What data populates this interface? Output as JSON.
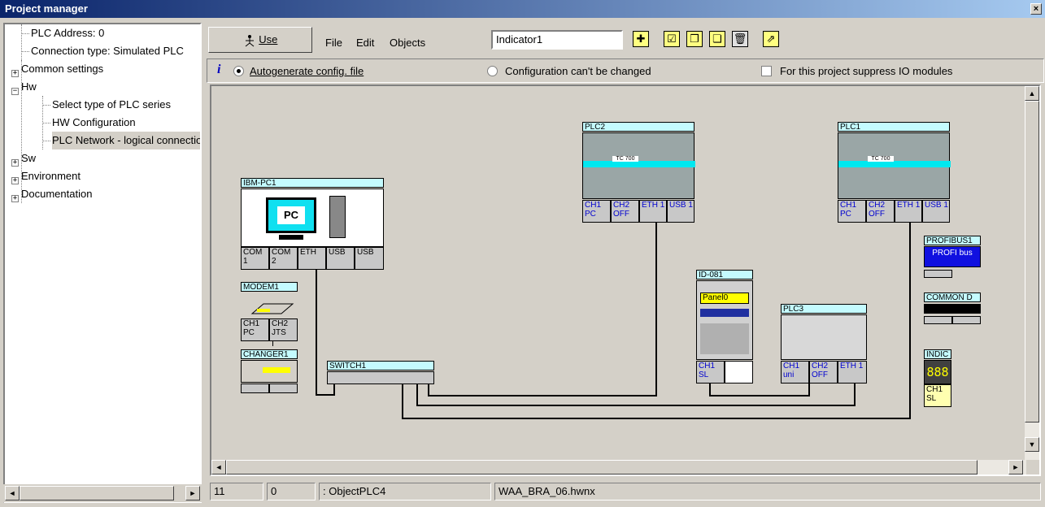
{
  "window": {
    "title": "Project manager",
    "close": "×"
  },
  "tree": {
    "items": [
      {
        "label": "PLC Address: 0"
      },
      {
        "label": "Connection type: Simulated PLC"
      },
      {
        "label": "Common settings",
        "toggle": "+"
      },
      {
        "label": "Hw",
        "toggle": "−"
      },
      {
        "label": "Select type of PLC series"
      },
      {
        "label": "HW Configuration"
      },
      {
        "label": "PLC Network - logical connections"
      },
      {
        "label": "Sw",
        "toggle": "+"
      },
      {
        "label": "Environment",
        "toggle": "+"
      },
      {
        "label": "Documentation",
        "toggle": "+"
      }
    ],
    "scroll_left": "◄",
    "scroll_right": "►"
  },
  "toolbar": {
    "use_label": "Use",
    "use_icon": "person-icon",
    "menu": [
      "File",
      "Edit",
      "Objects"
    ],
    "object_name": "Indicator1",
    "icons": [
      "new-object-icon",
      "check-icon",
      "copy-icon",
      "paste-icon",
      "delete-icon",
      "export-icon"
    ]
  },
  "options": {
    "info": "i",
    "autogen": "Autogenerate config. file",
    "cant_change": "Configuration can't be changed",
    "suppress": "For this project suppress IO modules"
  },
  "network": {
    "pc": {
      "title": "IBM-PC1",
      "screen": "PC",
      "ports": [
        "COM 1",
        "COM 2",
        "ETH",
        "USB",
        "USB"
      ]
    },
    "modem": {
      "title": "MODEM1",
      "ports": [
        "CH1 PC",
        "CH2 JTS"
      ]
    },
    "changer": {
      "title": "CHANGER1"
    },
    "switch": {
      "title": "SWITCH1"
    },
    "plc2": {
      "title": "PLC2",
      "module": "TC 700",
      "ports": [
        "CH1 PC",
        "CH2 OFF",
        "ETH 1",
        "USB 1"
      ]
    },
    "plc1": {
      "title": "PLC1",
      "module": "TC 700",
      "ports": [
        "CH1 PC",
        "CH2 OFF",
        "ETH 1",
        "USB 1"
      ]
    },
    "panel": {
      "title": "ID-081",
      "display": "Panel0",
      "ports": [
        "CH1 SL"
      ]
    },
    "plc3": {
      "title": "PLC3",
      "ports": [
        "CH1 uni",
        "CH2 OFF",
        "ETH 1"
      ]
    },
    "profibus": {
      "title": "PROFIBUS1",
      "text": "PROFI bus"
    },
    "common": {
      "title": "COMMON D"
    },
    "indic": {
      "title": "INDIC",
      "digits": "888",
      "port": "CH1 SL"
    }
  },
  "scroll": {
    "up": "▲",
    "down": "▼",
    "left": "◄",
    "right": "►"
  },
  "status": {
    "col1": "11",
    "col2": "0",
    "object": ": ObjectPLC4",
    "file": "WAA_BRA_06.hwnx"
  }
}
